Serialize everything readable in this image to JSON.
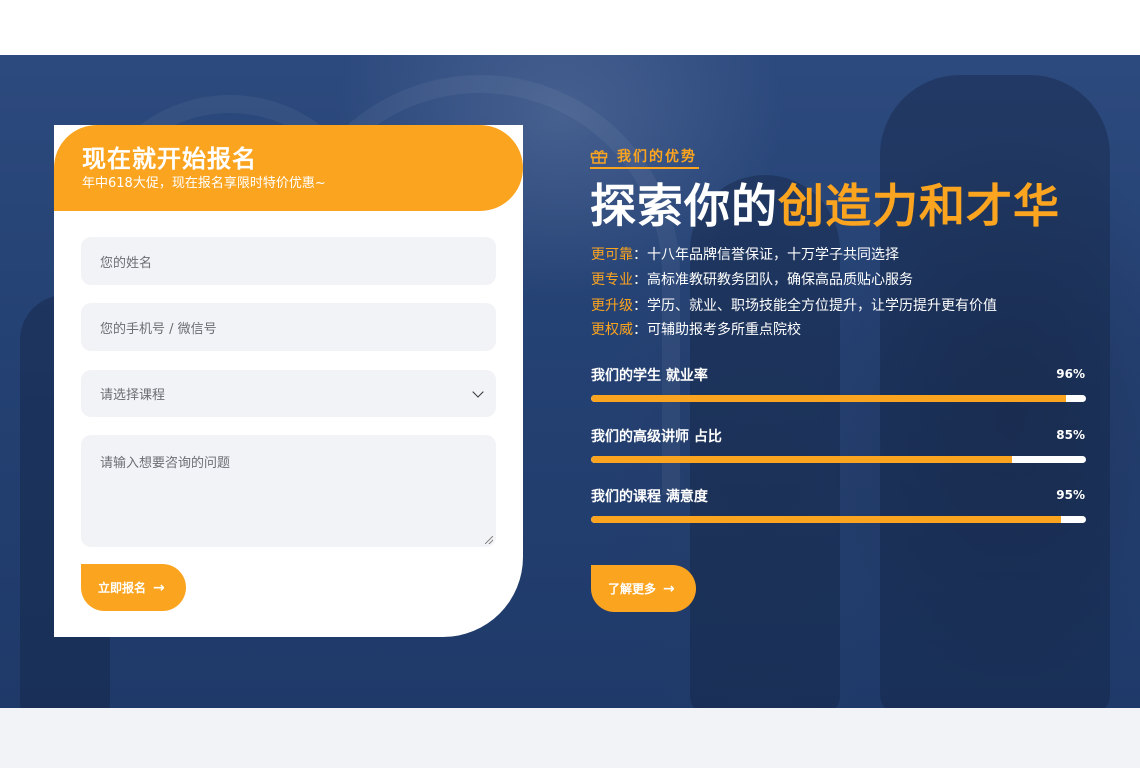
{
  "form": {
    "title": "现在就开始报名",
    "subtitle": "年中618大促，现在报名享限时特价优惠~",
    "name_placeholder": "您的姓名",
    "phone_placeholder": "您的手机号 / 微信号",
    "course_select_value": "请选择课程",
    "question_placeholder": "请输入想要咨询的问题",
    "submit_label": "立即报名",
    "submit_icon": "arrow-right-icon"
  },
  "advantages": {
    "tag": "我们的优势",
    "tag_icon": "gift-icon",
    "headline_white": "探索你的",
    "headline_accent": "创造力和才华",
    "features": [
      {
        "key": "更可靠",
        "sep": "：",
        "text": "十八年品牌信誉保证，十万学子共同选择"
      },
      {
        "key": "更专业",
        "sep": "：",
        "text": "高标准教研教务团队，确保高品质贴心服务"
      },
      {
        "key": "更升级",
        "sep": "：",
        "text": "学历、就业、职场技能全方位提升，让学历提升更有价值"
      },
      {
        "key": "更权威",
        "sep": "：",
        "text": "可辅助报考多所重点院校"
      }
    ],
    "stats": [
      {
        "label": "我们的学生 就业率",
        "percent_label": "96%",
        "value": 96
      },
      {
        "label": "我们的高级讲师 占比",
        "percent_label": "85%",
        "value": 85
      },
      {
        "label": "我们的课程 满意度",
        "percent_label": "95%",
        "value": 95
      }
    ],
    "more_label": "了解更多",
    "more_icon": "arrow-right-icon"
  },
  "colors": {
    "accent": "#fba41f",
    "hero_bg": "#244173",
    "field_bg": "#f2f3f6"
  }
}
